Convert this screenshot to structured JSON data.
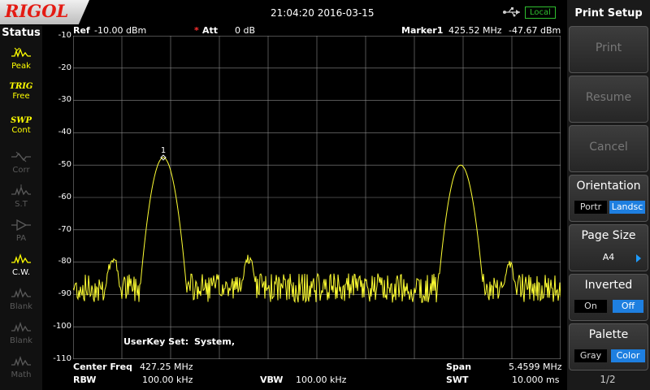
{
  "brand": {
    "logo_text": "RIGOL"
  },
  "topbar": {
    "datetime": "21:04:20 2016-03-15",
    "remote_status": "Local"
  },
  "status": {
    "title": "Status",
    "items": [
      {
        "line1": "Peak",
        "icon": "peak-wave-icon",
        "state": "on"
      },
      {
        "line1": "TRIG",
        "line2": "Free",
        "state": "on"
      },
      {
        "line1": "SWP",
        "line2": "Cont",
        "state": "on"
      },
      {
        "line1": "Corr",
        "icon": "corr-icon",
        "state": "off"
      },
      {
        "line1": "S.T",
        "icon": "s-t-icon",
        "state": "off"
      },
      {
        "line1": "PA",
        "icon": "pa-icon",
        "state": "off"
      },
      {
        "line1": "C.W.",
        "icon": "cw-wave-icon",
        "state": "on"
      },
      {
        "line1": "Blank",
        "icon": "blank-wave-icon",
        "state": "off"
      },
      {
        "line1": "Blank",
        "icon": "blank-wave-icon",
        "state": "off"
      },
      {
        "line1": "Math",
        "icon": "math-wave-icon",
        "state": "off"
      }
    ]
  },
  "header": {
    "ref_label": "Ref",
    "ref_value": "-10.00 dBm",
    "att_mark": "*",
    "att_label": "Att",
    "att_value": "0 dB",
    "marker_label": "Marker1",
    "marker_freq": "425.52 MHz",
    "marker_level": "-47.67 dBm"
  },
  "y_axis": {
    "labels": [
      "-10",
      "-20",
      "-30",
      "-40",
      "-50",
      "-60",
      "-70",
      "-80",
      "-90",
      "-100",
      "-110"
    ]
  },
  "spectrum": {
    "trace_color": "#ffff33",
    "grid_color": "#8a8a8a",
    "ref_db": -10,
    "bottom_db": -110,
    "noise_floor_db": -88,
    "peaks": [
      {
        "x_fraction": 0.185,
        "level_db": -47.67
      },
      {
        "x_fraction": 0.795,
        "level_db": -50.0
      }
    ],
    "spurs": [
      {
        "x_fraction": 0.082,
        "level_db": -79
      },
      {
        "x_fraction": 0.36,
        "level_db": -79
      },
      {
        "x_fraction": 0.895,
        "level_db": -81
      }
    ],
    "marker_label": "1"
  },
  "overlay": {
    "userkey_label": "UserKey Set:",
    "userkey_value": "System,"
  },
  "bottom": {
    "center_label": "Center Freq",
    "center_value": "427.25 MHz",
    "span_label": "Span",
    "span_value": "5.4599 MHz",
    "rbw_label": "RBW",
    "rbw_value": "100.00 kHz",
    "vbw_label": "VBW",
    "vbw_value": "100.00 kHz",
    "swt_label": "SWT",
    "swt_value": "10.000 ms"
  },
  "menu": {
    "title": "Print Setup",
    "print": "Print",
    "resume": "Resume",
    "cancel": "Cancel",
    "orientation": {
      "title": "Orientation",
      "opt1": "Portr",
      "opt2": "Landsc"
    },
    "pagesize": {
      "title": "Page Size",
      "value": "A4"
    },
    "inverted": {
      "title": "Inverted",
      "opt1": "On",
      "opt2": "Off"
    },
    "palette": {
      "title": "Palette",
      "opt1": "Gray",
      "opt2": "Color"
    },
    "page": "1/2"
  }
}
